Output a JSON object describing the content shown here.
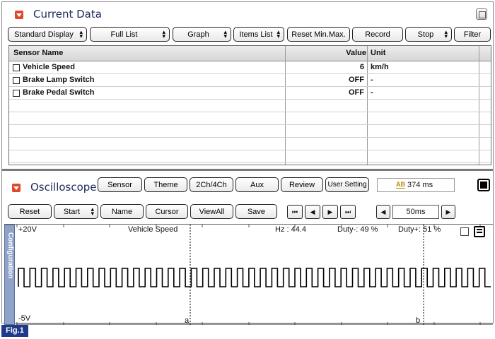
{
  "current_data": {
    "title": "Current Data",
    "toolbar": {
      "standard_display": "Standard Display",
      "full_list": "Full List",
      "graph": "Graph",
      "items_list": "Items List",
      "reset_min_max": "Reset Min.Max.",
      "record": "Record",
      "stop": "Stop",
      "filter": "Filter"
    },
    "table": {
      "headers": {
        "name": "Sensor Name",
        "value": "Value",
        "unit": "Unit"
      },
      "rows": [
        {
          "name": "Vehicle Speed",
          "value": "6",
          "unit": "km/h"
        },
        {
          "name": "Brake Lamp Switch",
          "value": "OFF",
          "unit": "-"
        },
        {
          "name": "Brake Pedal Switch",
          "value": "OFF",
          "unit": "-"
        }
      ]
    }
  },
  "oscilloscope": {
    "title": "Oscilloscope",
    "buttons": {
      "sensor": "Sensor",
      "theme": "Theme",
      "channels": "2Ch/4Ch",
      "aux": "Aux",
      "review": "Review",
      "user_setting": "User Setting"
    },
    "sample_interval": "374 ms",
    "toolbar": {
      "reset": "Reset",
      "start": "Start",
      "name": "Name",
      "cursor": "Cursor",
      "view_all": "ViewAll",
      "save": "Save"
    },
    "time_div": "50ms",
    "config_tab": "Configuration",
    "scope": {
      "y_max": "+20V",
      "y_min": "-5V",
      "channel": "Vehicle Speed",
      "hz": "Hz  : 44.4",
      "duty_minus": "Duty-: 49 %",
      "duty_plus": "Duty+: 51 %",
      "cursor_a": "a",
      "cursor_b": "b",
      "pulse_count": 41
    }
  },
  "figure_label": "Fig.1"
}
